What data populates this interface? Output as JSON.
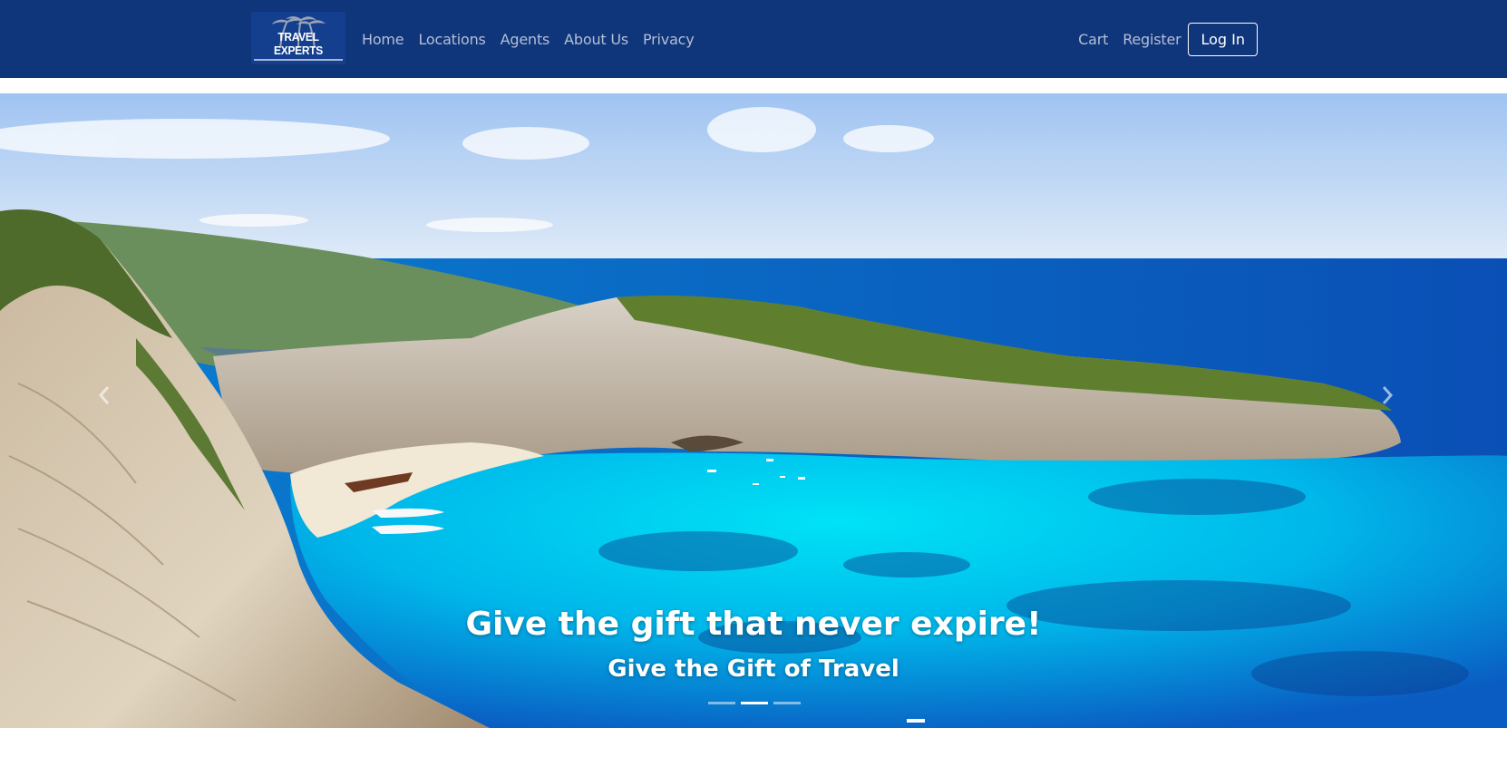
{
  "navbar": {
    "brand": {
      "logo_text": "TRAVEL EXPERTS",
      "logo_icon": "palm-trees-icon"
    },
    "links": [
      "Home",
      "Locations",
      "Agents",
      "About Us",
      "Privacy"
    ],
    "right_links": [
      "Cart",
      "Register"
    ],
    "login_label": "Log In"
  },
  "carousel": {
    "caption_title": "Give the gift that never expire!",
    "caption_subtitle": "Give the Gift of Travel",
    "slide_count": 3,
    "active_index": 1,
    "prev_icon": "chevron-left-icon",
    "next_icon": "chevron-right-icon"
  },
  "colors": {
    "navbar_bg": "#0f357a",
    "nav_link": "#b4bfd6",
    "sea": "#00c8ee",
    "sky": "#bcd3f1"
  }
}
